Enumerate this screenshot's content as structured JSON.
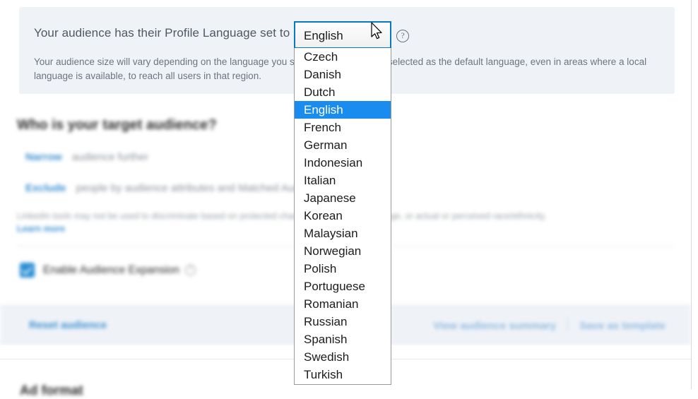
{
  "banner": {
    "line1": "Your audience has their Profile Language set to",
    "help_icon": "question-circle-icon",
    "body": "Your audience size will vary depending on the language you select. English may be selected as the default language, even in areas where a local language is available, to reach all users in that region."
  },
  "select": {
    "name": "profile-language-select",
    "value": "English",
    "state": "open",
    "options": [
      "Czech",
      "Danish",
      "Dutch",
      "English",
      "French",
      "German",
      "Indonesian",
      "Italian",
      "Japanese",
      "Korean",
      "Malaysian",
      "Norwegian",
      "Polish",
      "Portuguese",
      "Romanian",
      "Russian",
      "Spanish",
      "Swedish",
      "Turkish"
    ],
    "selected_index": 3
  },
  "content": {
    "section_title": "Who is your target audience?",
    "narrow_link": "Narrow",
    "narrow_rest": "audience further",
    "exclude_link": "Exclude",
    "exclude_rest": "people by audience attributes and Matched Audiences",
    "legal_note": "LinkedIn tools may not be used to discriminate based on protected characteristics like gender, age, or actual or perceived race/ethnicity.",
    "legal_link": "Learn more",
    "expansion_label": "Enable Audience Expansion",
    "expansion_checked": true,
    "expansion_help_icon": "question-circle-icon"
  },
  "footer": {
    "reset": "Reset audience",
    "view_summary": "View audience summary",
    "save_template": "Save as template"
  },
  "next_section": {
    "heading": "Ad format"
  },
  "colors": {
    "banner_bg": "#eff3f8",
    "link_blue": "#0a66c2",
    "highlight_blue": "#1a8cf0",
    "focus_border": "#0a78bd",
    "checkbox_blue": "#2a8fd4"
  }
}
